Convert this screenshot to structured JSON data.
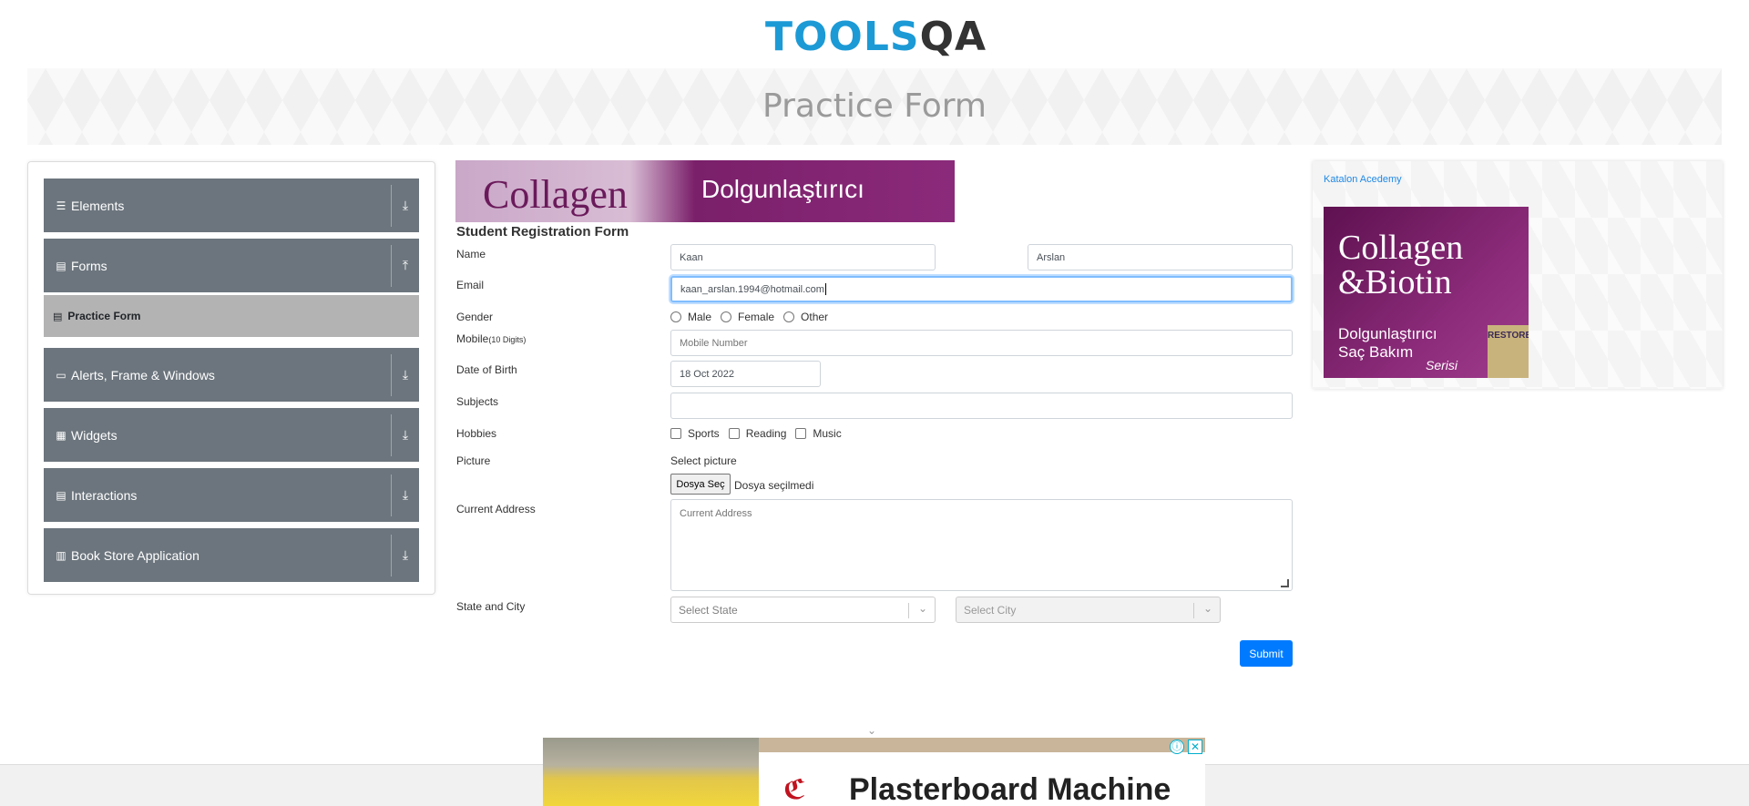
{
  "header": {
    "logo": {
      "part1": "TOOLS",
      "part2": "QA"
    },
    "page_title": "Practice Form"
  },
  "sidebar": {
    "groups": [
      {
        "label": "Elements",
        "icon": "menu-icon",
        "arrow": "⤓"
      },
      {
        "label": "Forms",
        "icon": "document-icon",
        "arrow": "⤒"
      },
      {
        "label": "Alerts, Frame & Windows",
        "icon": "window-icon",
        "arrow": "⤓"
      },
      {
        "label": "Widgets",
        "icon": "grid-icon",
        "arrow": "⤓"
      },
      {
        "label": "Interactions",
        "icon": "interaction-icon",
        "arrow": "⤓"
      },
      {
        "label": "Book Store Application",
        "icon": "books-icon",
        "arrow": "⤓"
      }
    ],
    "active_item": "Practice Form"
  },
  "ad_top": {
    "text1": "Collagen",
    "text2": "Dolgunlaştırıcı"
  },
  "form": {
    "title": "Student Registration Form",
    "name_label": "Name",
    "first_name": "Kaan",
    "last_name": "Arslan",
    "email_label": "Email",
    "email_value": "kaan_arslan.1994@hotmail.com",
    "gender_label": "Gender",
    "gender_options": [
      "Male",
      "Female",
      "Other"
    ],
    "mobile_label": "Mobile",
    "mobile_hint": "(10 Digits)",
    "mobile_placeholder": "Mobile Number",
    "dob_label": "Date of Birth",
    "dob_value": "18 Oct 2022",
    "subjects_label": "Subjects",
    "hobbies_label": "Hobbies",
    "hobbies": [
      "Sports",
      "Reading",
      "Music"
    ],
    "picture_label": "Picture",
    "picture_select": "Select picture",
    "file_button": "Dosya Seç",
    "file_status": "Dosya seçilmedi",
    "address_label": "Current Address",
    "address_placeholder": "Current Address",
    "state_city_label": "State and City",
    "state_placeholder": "Select State",
    "city_placeholder": "Select City",
    "submit_label": "Submit"
  },
  "right_ad": {
    "link_text": "Katalon Acedemy",
    "line1": "Collagen",
    "line2": "&Biotin",
    "line3": "Dolgunlaştırıcı",
    "line4": "Saç Bakım",
    "line5": "Serisi",
    "product": "RESTORE"
  },
  "bottom_ad": {
    "headline": "Plasterboard Machine",
    "info_icon": "ⓘ",
    "close_icon": "✕"
  },
  "colors": {
    "brand_blue": "#1c9ad6",
    "sidebar_grey": "#6c757d",
    "active_grey": "#b3b3b3",
    "submit_blue": "#007bff"
  }
}
